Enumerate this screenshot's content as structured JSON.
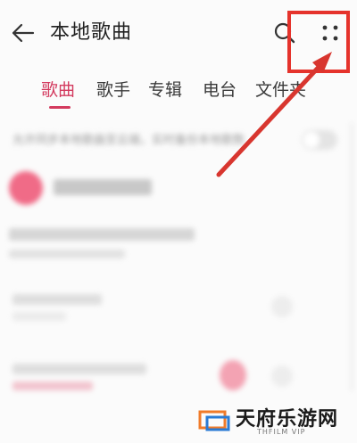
{
  "header": {
    "title": "本地歌曲",
    "back_icon": "back-arrow-icon",
    "search_icon": "search-icon",
    "more_icon": "more-dots-icon"
  },
  "tabs": [
    {
      "label": "歌曲",
      "active": true
    },
    {
      "label": "歌手",
      "active": false
    },
    {
      "label": "专辑",
      "active": false
    },
    {
      "label": "电台",
      "active": false
    },
    {
      "label": "文件夹",
      "active": false
    }
  ],
  "sync_setting": {
    "label": "允许同步本地歌曲至云端，实时备份本地歌数"
  },
  "colors": {
    "accent": "#d33a5e",
    "highlight": "#e5332c"
  },
  "watermark": {
    "name": "天府乐游网",
    "sub": "THFILM VIP"
  }
}
